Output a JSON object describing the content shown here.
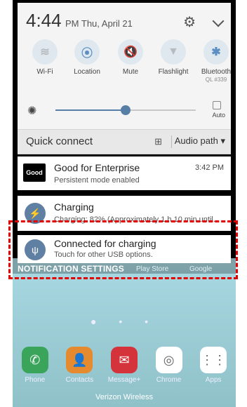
{
  "status": {
    "time": "4:44",
    "ampm_date": "PM  Thu, April 21"
  },
  "quick_settings": [
    {
      "label": "Wi-Fi",
      "icon": "wifi-icon",
      "glyph": "≋",
      "active": false
    },
    {
      "label": "Location",
      "icon": "location-icon",
      "glyph": "⦿",
      "active": true
    },
    {
      "label": "Mute",
      "icon": "mute-icon",
      "glyph": "🔇",
      "active": true
    },
    {
      "label": "Flashlight",
      "icon": "flashlight-icon",
      "glyph": "▼",
      "active": false
    },
    {
      "label": "Bluetooth",
      "icon": "bluetooth-icon",
      "glyph": "✱",
      "active": true,
      "sub": "QL #339"
    }
  ],
  "brightness": {
    "value": 0.5,
    "auto_label": "Auto"
  },
  "quick_connect": {
    "label": "Quick connect",
    "audio_path": "Audio path ▾"
  },
  "notifications": {
    "good": {
      "title": "Good for Enterprise",
      "subtitle": "Persistent mode enabled",
      "time": "3:42 PM",
      "logo": "Good"
    },
    "charging": {
      "title": "Charging",
      "subtitle": "Charging: 82% (Approximately 1 h 10 min until.."
    },
    "usb": {
      "title": "Connected for charging",
      "subtitle": "Touch for other USB options."
    }
  },
  "notification_settings": "NOTIFICATION SETTINGS",
  "behind": {
    "playstore": "Play Store",
    "google": "Google"
  },
  "dock_apps": [
    {
      "label": "Phone",
      "color": "#3aa45a",
      "glyph": "✆"
    },
    {
      "label": "Contacts",
      "color": "#e58a2e",
      "glyph": "👤"
    },
    {
      "label": "Message+",
      "color": "#d5333b",
      "glyph": "✉"
    },
    {
      "label": "Chrome",
      "color": "#ffffff",
      "glyph": "◎"
    },
    {
      "label": "Apps",
      "color": "#ffffff",
      "glyph": "⋮⋮"
    }
  ],
  "carrier": "Verizon Wireless"
}
